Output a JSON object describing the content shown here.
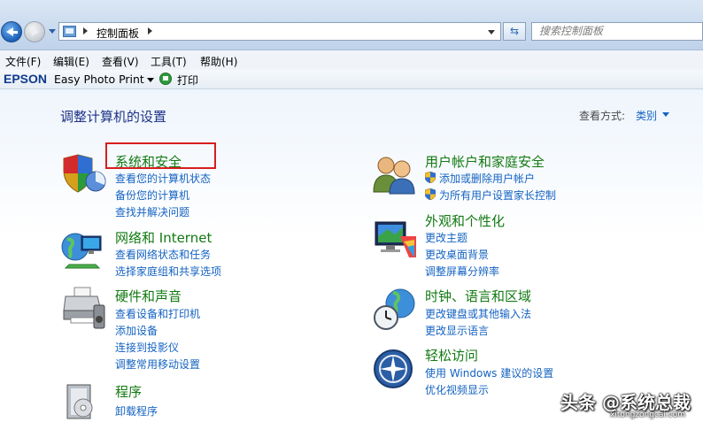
{
  "address": {
    "breadcrumb": "控制面板",
    "search_placeholder": "搜索控制面板"
  },
  "menu": [
    "文件(F)",
    "编辑(E)",
    "查看(V)",
    "工具(T)",
    "帮助(H)"
  ],
  "epson_bar": {
    "logo": "EPSON",
    "app": "Easy Photo Print",
    "print": "打印"
  },
  "main": {
    "title": "调整计算机的设置",
    "view_by_label": "查看方式:",
    "view_by_value": "类别"
  },
  "categories": [
    {
      "title": "系统和安全",
      "links": [
        "查看您的计算机状态",
        "备份您的计算机",
        "查找并解决问题"
      ]
    },
    {
      "title": "网络和 Internet",
      "links": [
        "查看网络状态和任务",
        "选择家庭组和共享选项"
      ]
    },
    {
      "title": "硬件和声音",
      "links": [
        "查看设备和打印机",
        "添加设备",
        "连接到投影仪",
        "调整常用移动设置"
      ]
    },
    {
      "title": "程序",
      "links": [
        "卸载程序"
      ]
    },
    {
      "title": "用户帐户和家庭安全",
      "links": [
        "添加或删除用户帐户",
        "为所有用户设置家长控制"
      ]
    },
    {
      "title": "外观和个性化",
      "links": [
        "更改主题",
        "更改桌面背景",
        "调整屏幕分辨率"
      ]
    },
    {
      "title": "时钟、语言和区域",
      "links": [
        "更改键盘或其他输入法",
        "更改显示语言"
      ]
    },
    {
      "title": "轻松访问",
      "links": [
        "使用 Windows 建议的设置",
        "优化视频显示"
      ]
    }
  ],
  "watermark": {
    "text": "头条 @系统总裁",
    "url": "xitongzongcai.com"
  },
  "colors": {
    "category_title": "#127a12",
    "link": "#1463c2",
    "page_title": "#1e3287",
    "highlight": "#d81e1e"
  }
}
